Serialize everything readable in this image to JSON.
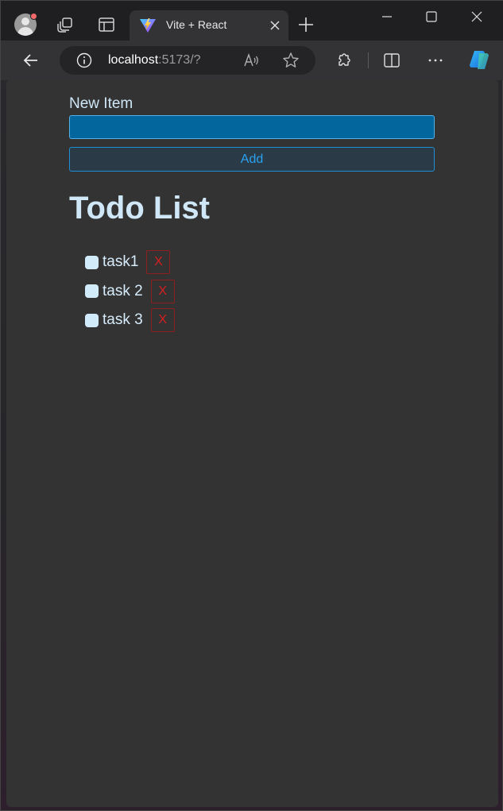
{
  "browser": {
    "tab_title": "Vite + React",
    "url_host": "localhost",
    "url_rest": ":5173/?"
  },
  "form": {
    "label": "New Item",
    "input_value": "",
    "add_label": "Add"
  },
  "list": {
    "heading": "Todo List",
    "items": [
      {
        "text": "task1",
        "checked": false,
        "delete_label": "X"
      },
      {
        "text": "task 2",
        "checked": false,
        "delete_label": "X"
      },
      {
        "text": "task 3",
        "checked": false,
        "delete_label": "X"
      }
    ]
  },
  "colors": {
    "accent": "#2aa2f2",
    "input_bg": "#03679e",
    "danger": "#d61f1f",
    "page_bg": "#333333"
  },
  "icons": [
    "profile-icon",
    "workspaces-icon",
    "tab-actions-icon",
    "vite-icon",
    "close-icon",
    "new-tab-icon",
    "minimize-icon",
    "maximize-icon",
    "window-close-icon",
    "back-icon",
    "info-icon",
    "read-aloud-icon",
    "favorite-icon",
    "extensions-icon",
    "split-screen-icon",
    "more-icon",
    "copilot-icon"
  ]
}
